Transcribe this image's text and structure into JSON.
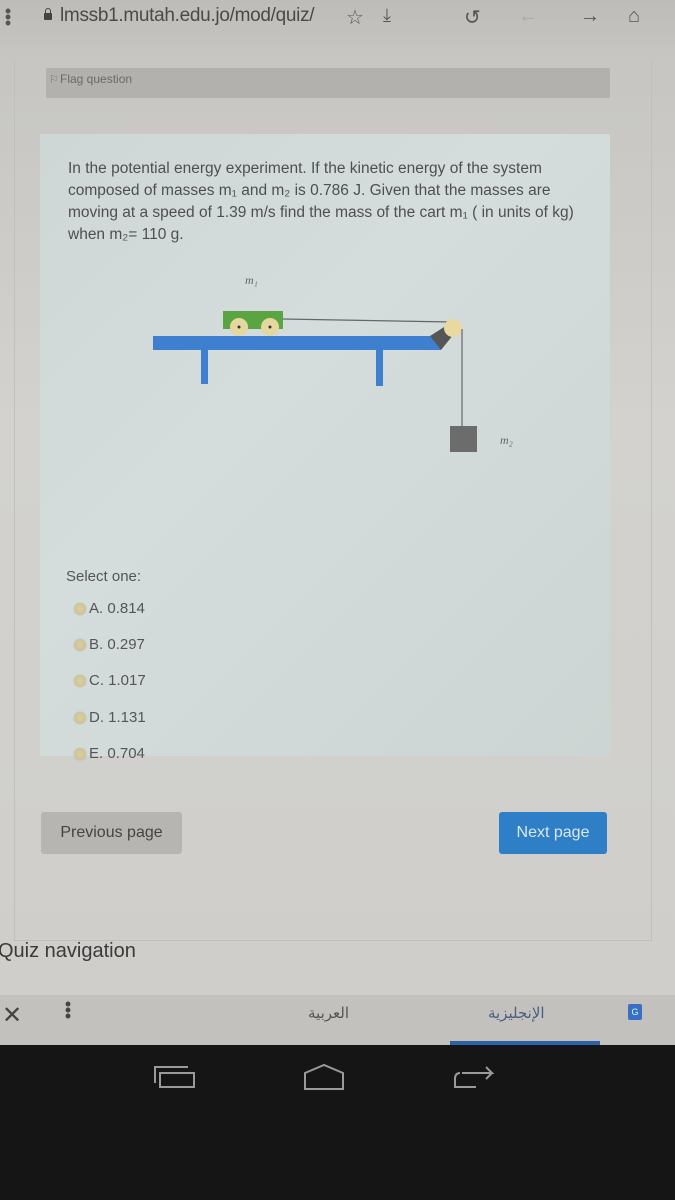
{
  "browser": {
    "menu_icon": "overflow-menu-icon",
    "lock_icon": "lock-icon",
    "url": "lmssb1.mutah.edu.jo/mod/quiz/",
    "toolbar_icons": [
      "star-icon",
      "download-icon",
      "reload-icon",
      "back-arrow-icon",
      "forward-arrow-icon",
      "home-icon"
    ]
  },
  "question": {
    "flag_label": "Flag question",
    "text": "In the potential energy experiment. If the kinetic energy of the system composed of masses m₁ and m₂ is 0.786 J. Given that the masses are moving at a speed of 1.39 m/s find the mass of the cart m₁ ( in units of kg) when m₂= 110 g.",
    "diagram": {
      "label_m1": "m₁",
      "label_m2": "m₂",
      "colors": {
        "track": "#3f7fd0",
        "cart": "#5aa444",
        "wheel": "#e5d7a0",
        "mass": "#6c6c6c",
        "pulley": "#e8d9a0"
      }
    },
    "select_label": "Select one:",
    "options": [
      {
        "letter": "A.",
        "value": "0.814"
      },
      {
        "letter": "B.",
        "value": "0.297"
      },
      {
        "letter": "C.",
        "value": "1.017"
      },
      {
        "letter": "D.",
        "value": "1.131"
      },
      {
        "letter": "E.",
        "value": "0.704"
      }
    ]
  },
  "navigation": {
    "previous_label": "Previous page",
    "next_label": "Next page",
    "next_color": "#2f7fc7",
    "quiz_nav_title": "Quiz navigation"
  },
  "translate_bar": {
    "close_icon": "close-icon",
    "menu_icon": "overflow-menu-icon",
    "lang_arabic": "العربية",
    "lang_english": "الإنجليزية",
    "active_lang": "الإنجليزية",
    "translate_icon": "google-translate-icon"
  },
  "system_nav": {
    "icons": [
      "recent-apps-icon",
      "home-icon",
      "back-icon"
    ]
  }
}
